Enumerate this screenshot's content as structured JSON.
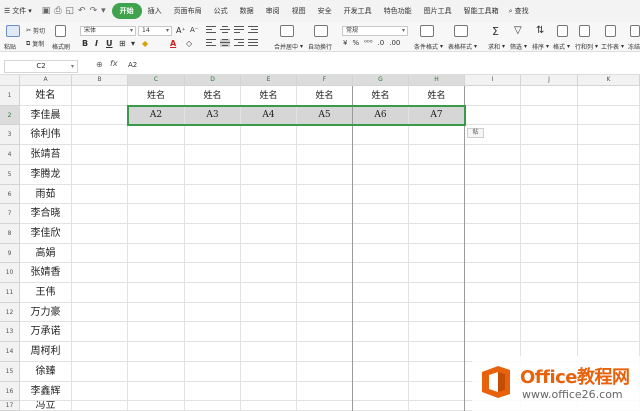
{
  "menubar": {
    "file_label": "文件",
    "tabs": [
      "开始",
      "插入",
      "页面布局",
      "公式",
      "数据",
      "审阅",
      "视图",
      "安全",
      "开发工具",
      "特色功能",
      "图片工具",
      "智能工具箱"
    ],
    "active_tab": "开始",
    "search_label": "查找"
  },
  "ribbon": {
    "paste": "粘贴",
    "cut": "剪切",
    "copy": "复制",
    "format_painter": "格式刷",
    "font_name": "宋体",
    "font_size": "14",
    "merge_center": "合并居中",
    "wrap_text": "自动换行",
    "number_format": "常规",
    "conditional_format": "条件格式",
    "table_style": "表格样式",
    "sum": "求和",
    "filter": "筛选",
    "sort": "排序",
    "format": "格式",
    "row_col": "行和列",
    "worksheet": "工作表",
    "freeze": "冻结"
  },
  "formula_bar": {
    "name_box": "C2",
    "fx": "fx",
    "value": "A2"
  },
  "columns": [
    "A",
    "B",
    "C",
    "D",
    "E",
    "F",
    "G",
    "H",
    "I",
    "J",
    "K"
  ],
  "rows": [
    "1",
    "2",
    "3",
    "4",
    "5",
    "6",
    "7",
    "8",
    "9",
    "10",
    "11",
    "12",
    "13",
    "14",
    "15",
    "16",
    "17"
  ],
  "column_a": [
    "姓名",
    "李佳晨",
    "徐利伟",
    "张靖苔",
    "李腾龙",
    "雨茹",
    "李合晓",
    "李佳欣",
    "高娟",
    "张婧香",
    "王伟",
    "万力豪",
    "万承诺",
    "周柯利",
    "徐臻",
    "李鑫辉",
    "冯立"
  ],
  "row1_headers": [
    "姓名",
    "姓名",
    "姓名",
    "姓名",
    "姓名",
    "姓名"
  ],
  "row2_values": [
    "A2",
    "A3",
    "A4",
    "A5",
    "A6",
    "A7"
  ],
  "paste_options": "粘",
  "watermark": {
    "title": "Office教程网",
    "url": "www.office26.com"
  },
  "colors": {
    "accent_green": "#3fa34d",
    "selection_border": "#3a9a4a",
    "watermark_orange": "#e8620c"
  }
}
